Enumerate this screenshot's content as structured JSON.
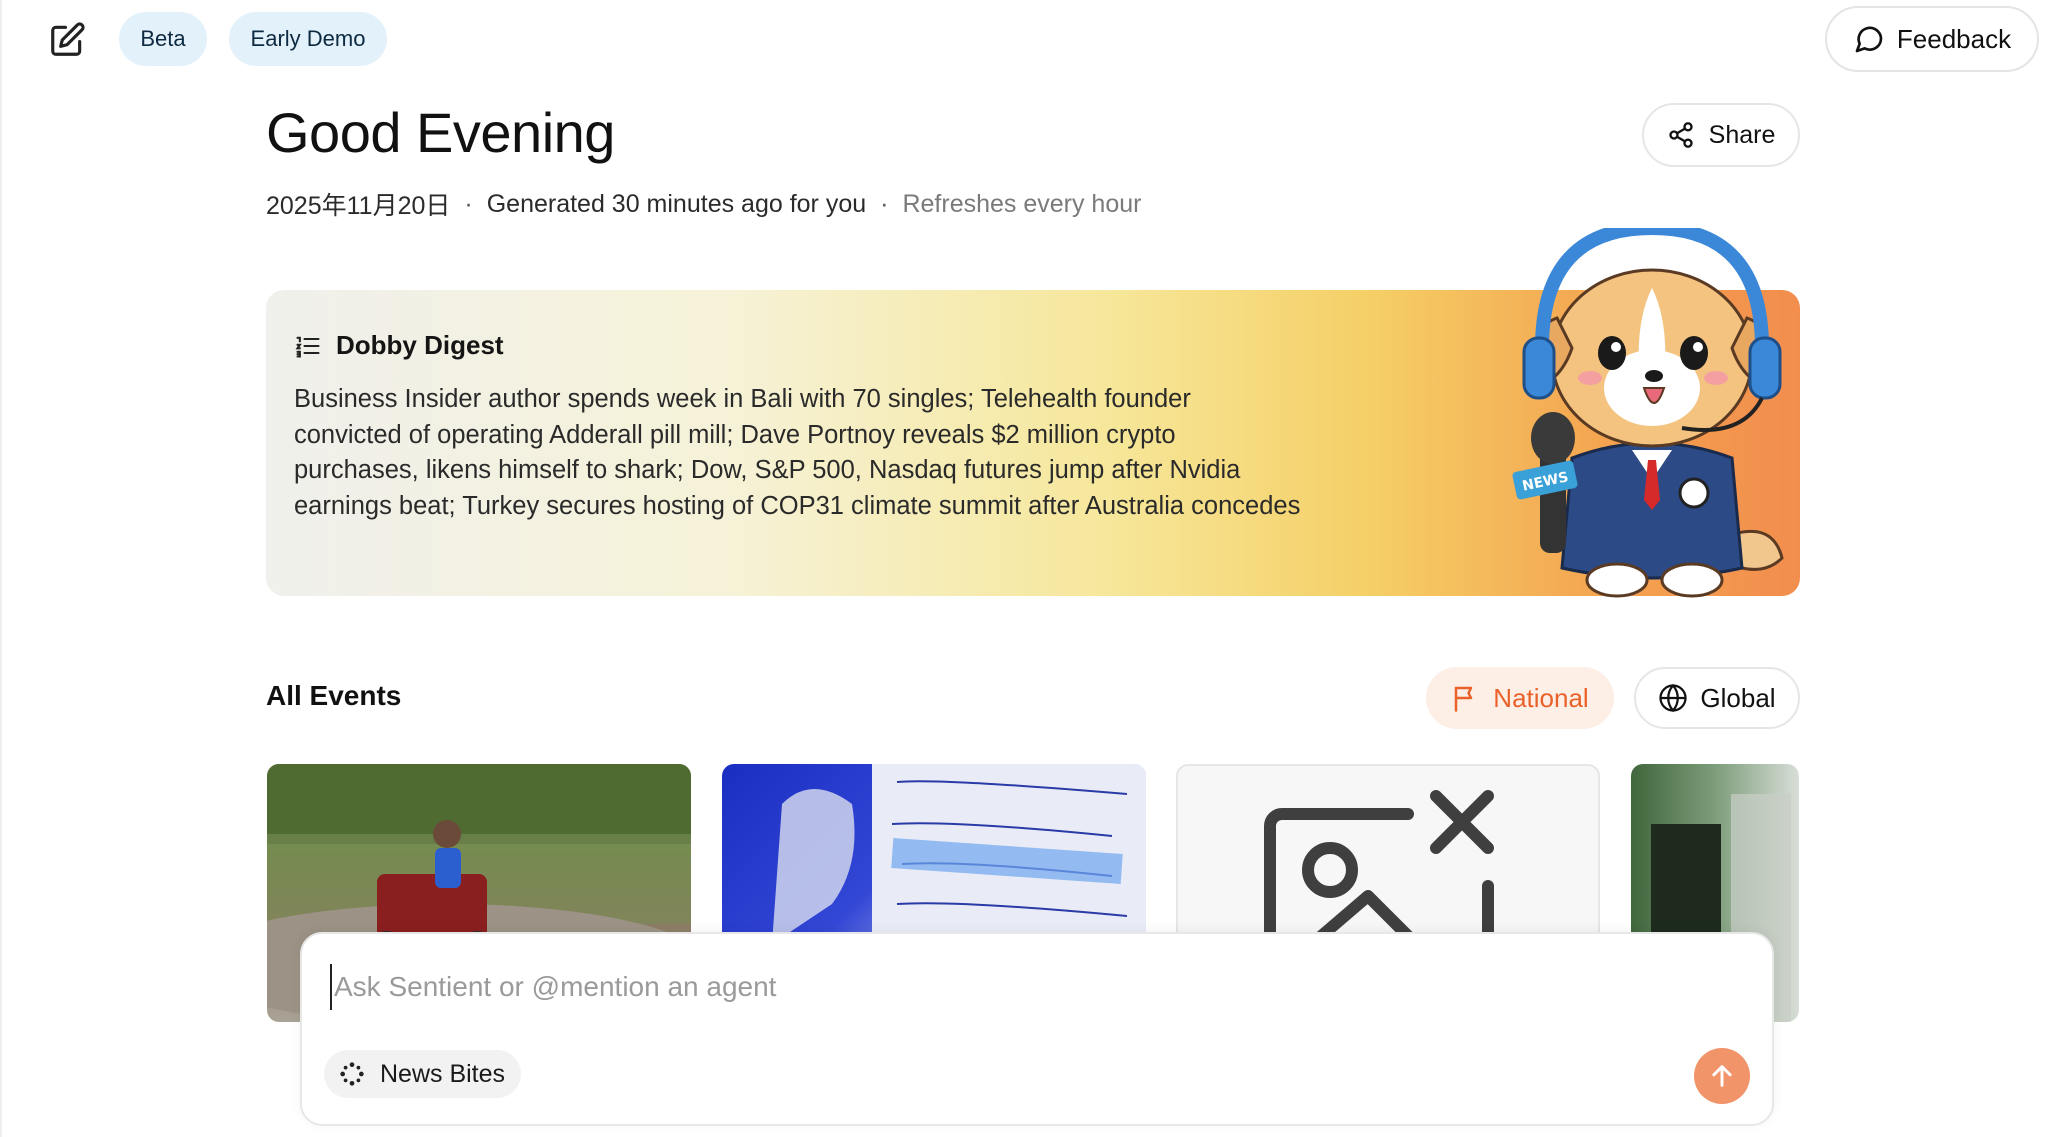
{
  "topbar": {
    "edit_icon": "edit-square-icon",
    "badges": [
      "Beta",
      "Early Demo"
    ],
    "feedback_label": "Feedback",
    "feedback_icon": "chat-bubble-icon"
  },
  "header": {
    "title": "Good Evening",
    "date": "2025年11月20日",
    "generated": "Generated 30 minutes ago for you",
    "refresh": "Refreshes every hour",
    "share_label": "Share",
    "share_icon": "share-nodes-icon"
  },
  "digest": {
    "title": "Dobby Digest",
    "icon": "numbered-list-icon",
    "body": "Business Insider author spends week in Bali with 70 singles; Telehealth founder convicted of operating Adderall pill mill; Dave Portnoy reveals $2 million crypto purchases, likens himself to shark; Dow, S&P 500, Nasdaq futures jump after Nvidia earnings beat; Turkey secures hosting of COP31 climate summit after Australia concedes",
    "mascot": "dog-news-reporter-mascot",
    "mascot_mic_label": "NEWS"
  },
  "events": {
    "title": "All Events",
    "tabs": [
      {
        "label": "National",
        "icon": "flag-icon",
        "active": true
      },
      {
        "label": "Global",
        "icon": "globe-icon",
        "active": false
      }
    ],
    "cards": [
      {
        "image": "atv-riders-jungle-photo"
      },
      {
        "image": "vaccine-whiteboard-photo"
      },
      {
        "image": "image-placeholder-icon"
      },
      {
        "image": "studio-equipment-photo"
      }
    ]
  },
  "composer": {
    "placeholder": "Ask Sentient or @mention an agent",
    "value": "",
    "chip_label": "News Bites",
    "chip_icon": "sparkle-dots-icon",
    "send_icon": "arrow-up-icon"
  },
  "colors": {
    "accent": "#e8622a",
    "badge_bg": "#e3f1fb",
    "send_bg": "#f2946a"
  }
}
